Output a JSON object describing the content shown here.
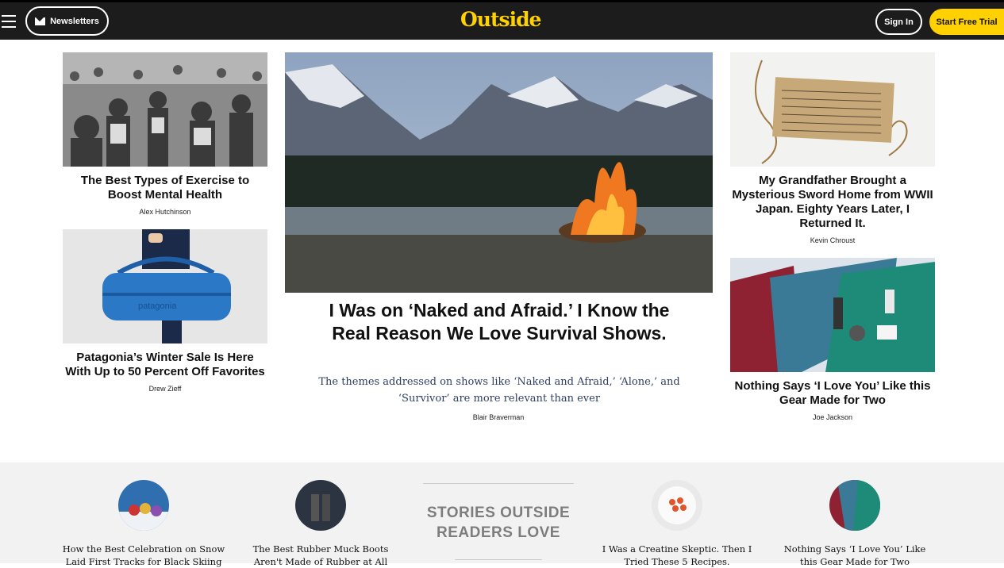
{
  "header": {
    "newsletters_label": "Newsletters",
    "logo": "Outside",
    "signin_label": "Sign In",
    "trial_label": "Start Free Trial"
  },
  "colors": {
    "brand_yellow": "#ffd100",
    "header_bg": "#1c1c1c",
    "dek_color": "#2d3f60"
  },
  "left_column": [
    {
      "title": "The Best Types of Exercise to Boost Mental Health",
      "author": "Alex Hutchinson"
    },
    {
      "title": "Patagonia’s Winter Sale Is Here With Up to 50 Percent Off Favorites",
      "author": "Drew Zieff"
    }
  ],
  "hero": {
    "title": "I Was on ‘Naked and Afraid.’ I Know the Real Reason We Love Survival Shows.",
    "dek": "The themes addressed on shows like ‘Naked and Afraid,’ ‘Alone,’ and ‘Survivor’ are more relevant than ever",
    "author": "Blair Braverman"
  },
  "right_column": [
    {
      "title": "My Grandfather Brought a Mysterious Sword Home from WWII Japan. Eighty Years Later, I Returned It.",
      "author": "Kevin Chroust"
    },
    {
      "title": "Nothing Says ‘I Love You’ Like this Gear Made for Two",
      "author": "Joe Jackson"
    }
  ],
  "stories_section": {
    "heading_line1": "STORIES OUTSIDE",
    "heading_line2": "READERS LOVE",
    "items": [
      {
        "title": "How the Best Celebration on Snow Laid First Tracks for Black Skiing"
      },
      {
        "title": "The Best Rubber Muck Boots Aren't Made of Rubber at All"
      },
      {
        "title": "I Was a Creatine Skeptic. Then I Tried These 5 Recipes."
      },
      {
        "title": "Nothing Says ‘I Love You’ Like this Gear Made for Two"
      }
    ]
  }
}
